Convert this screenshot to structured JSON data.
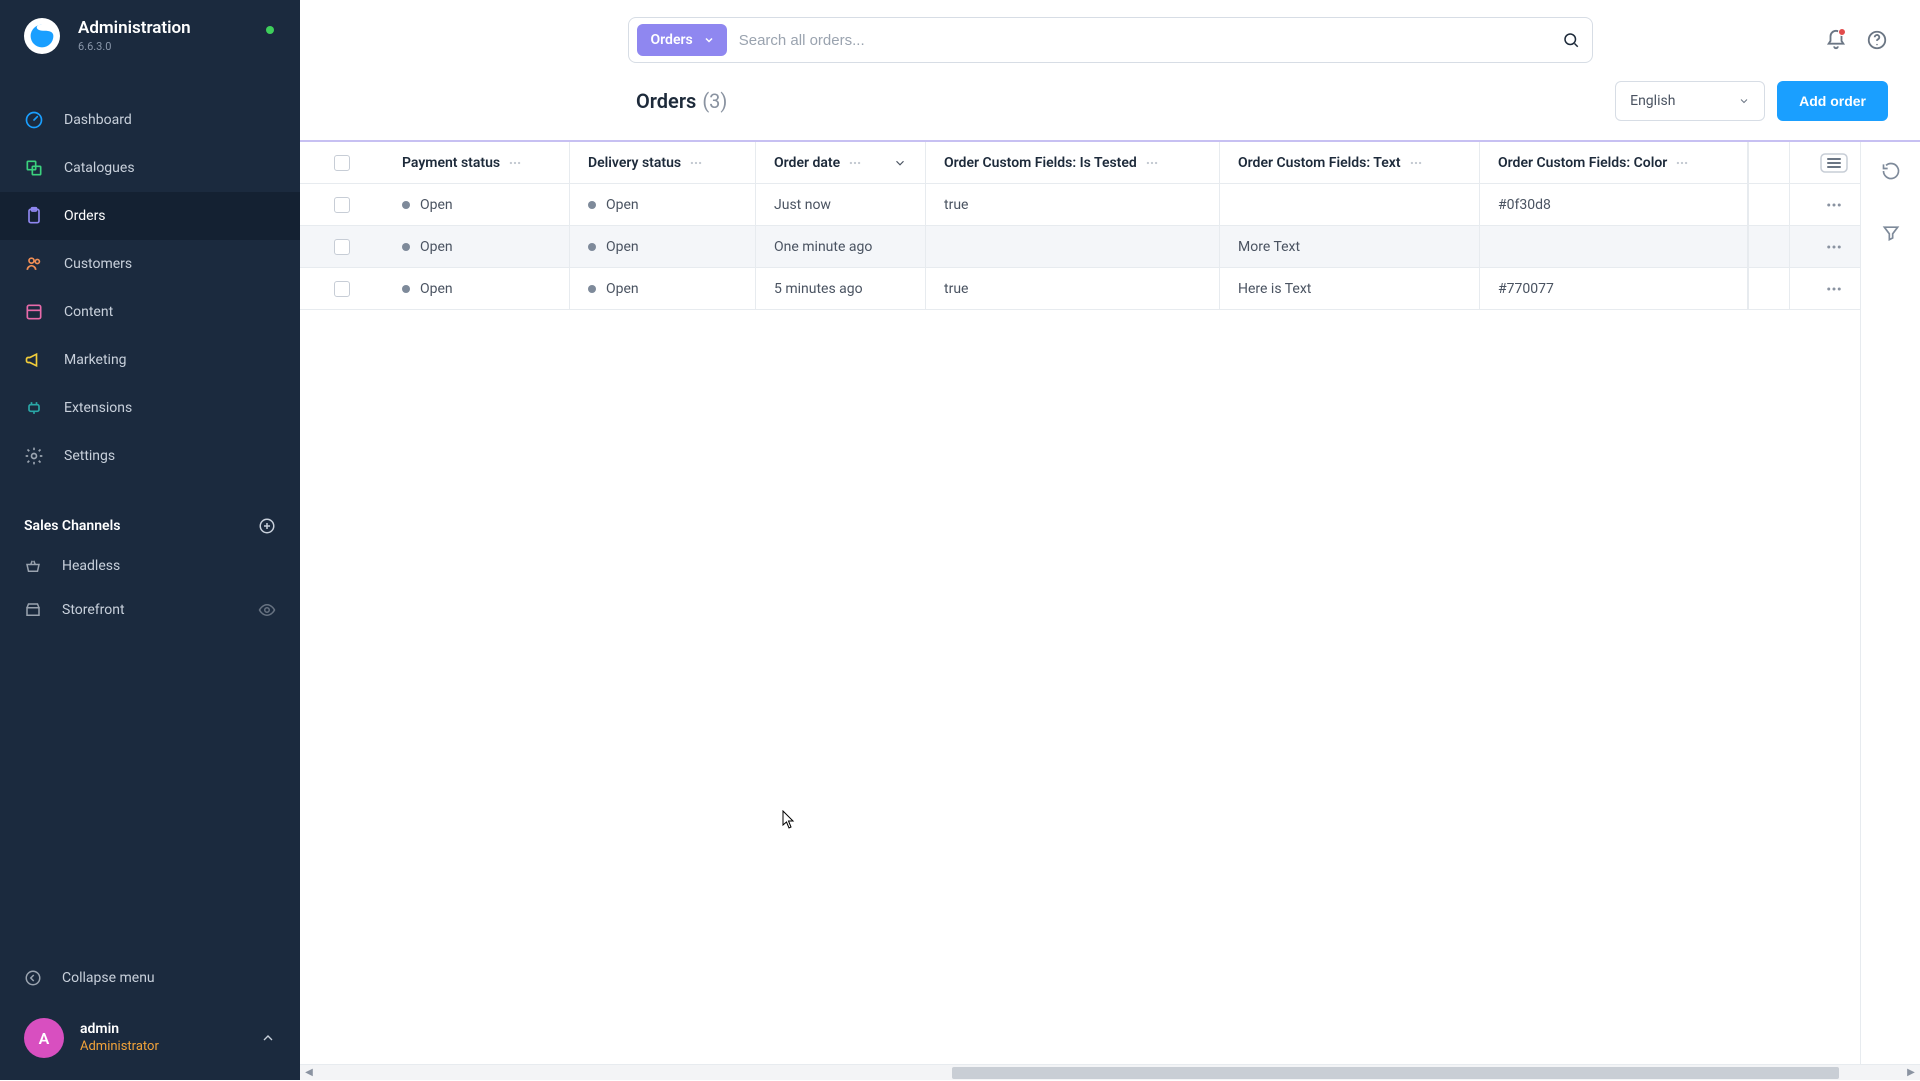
{
  "brand": {
    "title": "Administration",
    "version": "6.6.3.0"
  },
  "nav": {
    "dashboard": "Dashboard",
    "catalogues": "Catalogues",
    "orders": "Orders",
    "customers": "Customers",
    "content": "Content",
    "marketing": "Marketing",
    "extensions": "Extensions",
    "settings": "Settings"
  },
  "channels": {
    "section_title": "Sales Channels",
    "headless": "Headless",
    "storefront": "Storefront"
  },
  "sidebar_footer": {
    "collapse": "Collapse menu"
  },
  "user": {
    "avatar_letter": "A",
    "name": "admin",
    "role": "Administrator"
  },
  "search": {
    "scope_label": "Orders",
    "placeholder": "Search all orders..."
  },
  "page": {
    "title": "Orders",
    "count_label": "(3)",
    "language": "English",
    "add_button": "Add order"
  },
  "columns": {
    "payment_status": "Payment status",
    "delivery_status": "Delivery status",
    "order_date": "Order date",
    "is_tested": "Order Custom Fields: Is Tested",
    "text": "Order Custom Fields: Text",
    "color": "Order Custom Fields: Color"
  },
  "status_labels": {
    "open": "Open"
  },
  "rows": [
    {
      "payment": "Open",
      "delivery": "Open",
      "date": "Just now",
      "is_tested": "true",
      "text": "",
      "color": "#0f30d8"
    },
    {
      "payment": "Open",
      "delivery": "Open",
      "date": "One minute ago",
      "is_tested": "",
      "text": "More Text",
      "color": ""
    },
    {
      "payment": "Open",
      "delivery": "Open",
      "date": "5 minutes ago",
      "is_tested": "true",
      "text": "Here is Text",
      "color": "#770077"
    }
  ]
}
